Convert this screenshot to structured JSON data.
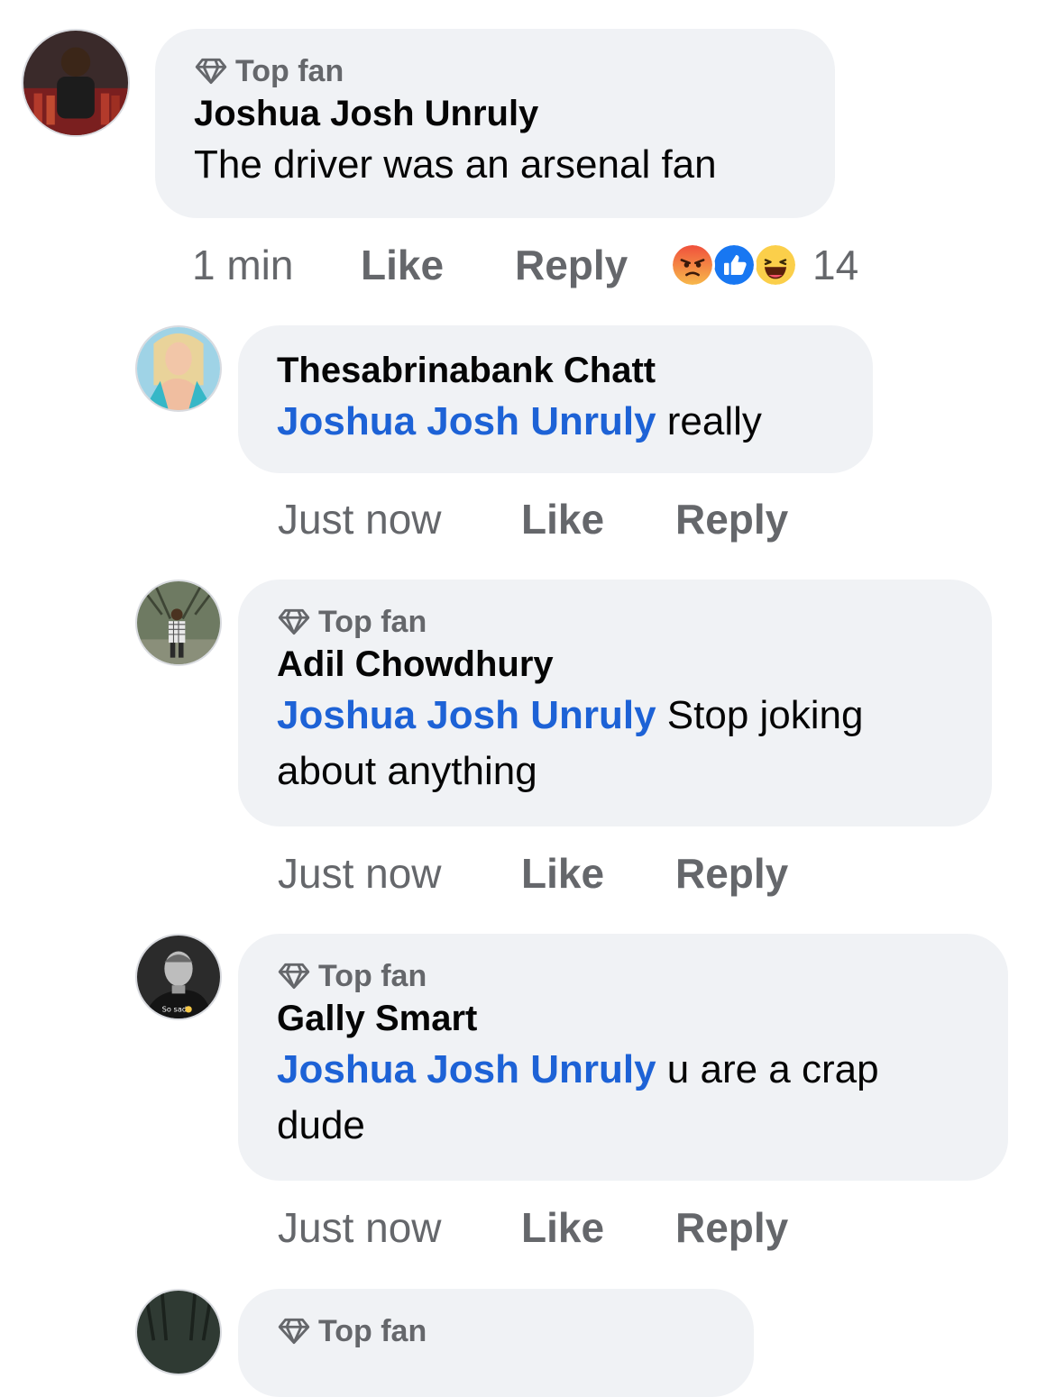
{
  "comments": [
    {
      "top_fan": "Top fan",
      "author": "Joshua Josh Unruly",
      "text": "The driver was an arsenal fan",
      "time": "1 min",
      "like": "Like",
      "reply": "Reply",
      "reaction_count": "14",
      "reactions": [
        "angry-icon",
        "like-icon",
        "haha-icon"
      ]
    },
    {
      "author": "Thesabrinabank Chatt",
      "mention": "Joshua Josh Unruly",
      "text": " really",
      "time": "Just now",
      "like": "Like",
      "reply": "Reply"
    },
    {
      "top_fan": "Top fan",
      "author": "Adil Chowdhury",
      "mention": "Joshua Josh Unruly",
      "text": " Stop joking about anything",
      "time": "Just now",
      "like": "Like",
      "reply": "Reply"
    },
    {
      "top_fan": "Top fan",
      "author": "Gally Smart",
      "mention": "Joshua Josh Unruly",
      "text": " u are a crap dude",
      "time": "Just now",
      "like": "Like",
      "reply": "Reply",
      "avatar_caption": "So sad"
    },
    {
      "top_fan": "Top fan"
    }
  ],
  "colors": {
    "bubble": "#f0f2f5",
    "mention": "#1d62d6",
    "meta": "#65676b"
  }
}
